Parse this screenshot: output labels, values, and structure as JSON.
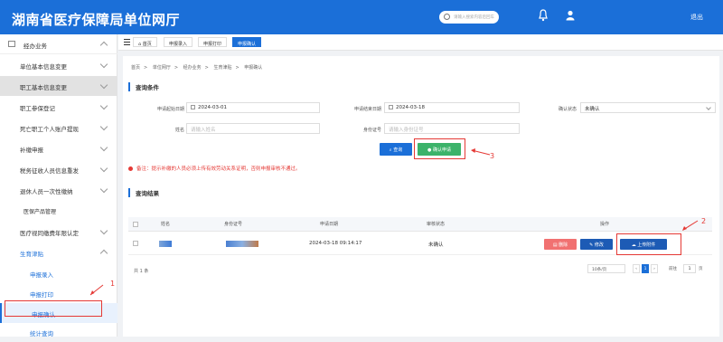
{
  "header": {
    "title": "湖南省医疗保障局单位网厅",
    "search_placeholder": "请输入搜索内容后回车",
    "logout": "退出"
  },
  "sidebar": {
    "group": "经办业务",
    "items": [
      "单位基本信息变更",
      "职工基本信息变更",
      "职工参保登记",
      "死亡职工个人账户提现",
      "补缴申报",
      "税务征收人员信息重发",
      "退休人员一次性缴纳",
      "医保产品管理",
      "医疗视同缴费年限认定",
      "生育津贴"
    ],
    "subitems": [
      "申报录入",
      "申报打印",
      "申报确认",
      "统计查询"
    ]
  },
  "tabs": [
    "首页",
    "申报录入",
    "申报打印",
    "申报确认"
  ],
  "breadcrumb": [
    "首页",
    "单位网厅",
    "经办业务",
    "生育津贴",
    "申报确认"
  ],
  "query": {
    "title": "查询条件",
    "start_date_label": "申请起始日期",
    "start_date": "2024-03-01",
    "end_date_label": "申请结束日期",
    "end_date": "2024-03-18",
    "status_label": "确认状态",
    "status_value": "未确认",
    "name_label": "姓名",
    "name_placeholder": "请输入姓名",
    "id_label": "身份证号",
    "id_placeholder": "请输入身份证号",
    "query_btn": "查询",
    "confirm_btn": "确认申请"
  },
  "note": "备注：提示补缴的人员必须上传有效劳动关系证明，否则申报审核不通过。",
  "results": {
    "title": "查询结果",
    "columns": [
      "姓名",
      "身份证号",
      "申请日期",
      "审核状态",
      "操作"
    ],
    "rows": [
      {
        "date": "2024-03-18 09:14:17",
        "status": "未确认"
      }
    ],
    "btn_delete": "删除",
    "btn_edit": "修改",
    "btn_upload": "上传附件"
  },
  "pagination": {
    "total": "共 1 条",
    "size": "10条/页",
    "current": "1",
    "goto": "前往",
    "page_word": "页"
  },
  "annotations": [
    "1",
    "2",
    "3"
  ]
}
